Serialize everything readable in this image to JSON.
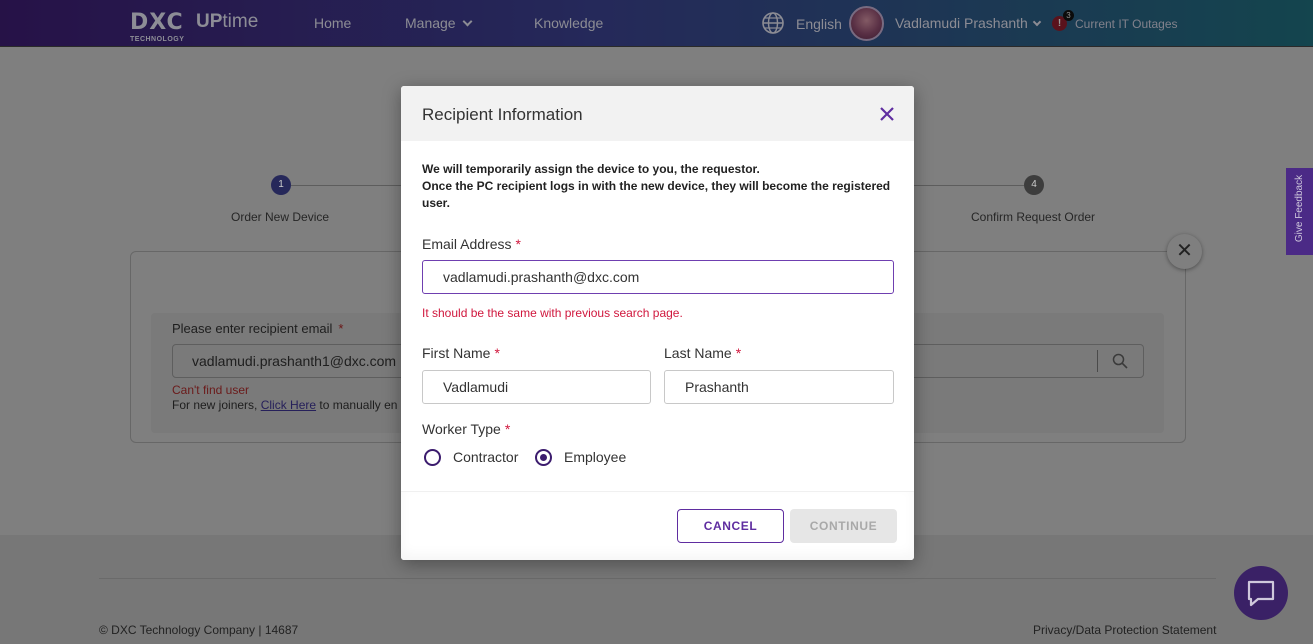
{
  "header": {
    "logo_dxc": "DXC",
    "logo_technology": "TECHNOLOGY",
    "logo_up": "UP",
    "logo_time": "time",
    "nav": {
      "home": "Home",
      "manage": "Manage",
      "knowledge": "Knowledge"
    },
    "language": "English",
    "user_name": "Vadlamudi Prashanth",
    "outage_count": "3",
    "outage_badge_icon": "!",
    "outages_label": "Current IT Outages"
  },
  "stepper": {
    "step1_number": "1",
    "step1_label": "Order New Device",
    "step4_number": "4",
    "step4_label": "Confirm Request Order"
  },
  "background_form": {
    "label": "Please enter recipient email",
    "required_mark": "*",
    "email_value": "vadlamudi.prashanth1@dxc.com",
    "error": "Can't find user",
    "joiners_prefix": "For new joiners,",
    "joiners_link": "Click Here",
    "joiners_suffix": "to manually en",
    "close_symbol": "✕"
  },
  "feedback": {
    "label": "Give Feedback"
  },
  "footer": {
    "copyright": "© DXC Technology Company | 14687",
    "privacy": "Privacy/Data Protection Statement"
  },
  "modal": {
    "title": "Recipient Information",
    "info_line1": "We will temporarily assign the device to you, the requestor.",
    "info_line2": "Once the PC recipient logs in with the new device, they will become the registered user.",
    "required_mark": "*",
    "email_label": "Email Address",
    "email_value": "vadlamudi.prashanth@dxc.com",
    "email_error": "It should be the same with previous search page.",
    "first_name_label": "First Name",
    "first_name_value": "Vadlamudi",
    "last_name_label": "Last Name",
    "last_name_value": "Prashanth",
    "worker_type_label": "Worker Type",
    "worker_types": [
      {
        "label": "Contractor",
        "selected": false
      },
      {
        "label": "Employee",
        "selected": true
      }
    ],
    "cancel_label": "CANCEL",
    "continue_label": "CONTINUE"
  },
  "colors": {
    "accent_purple": "#5f2da0",
    "error_red": "#d0173d",
    "overlay_gray": "#7f7f7f"
  }
}
